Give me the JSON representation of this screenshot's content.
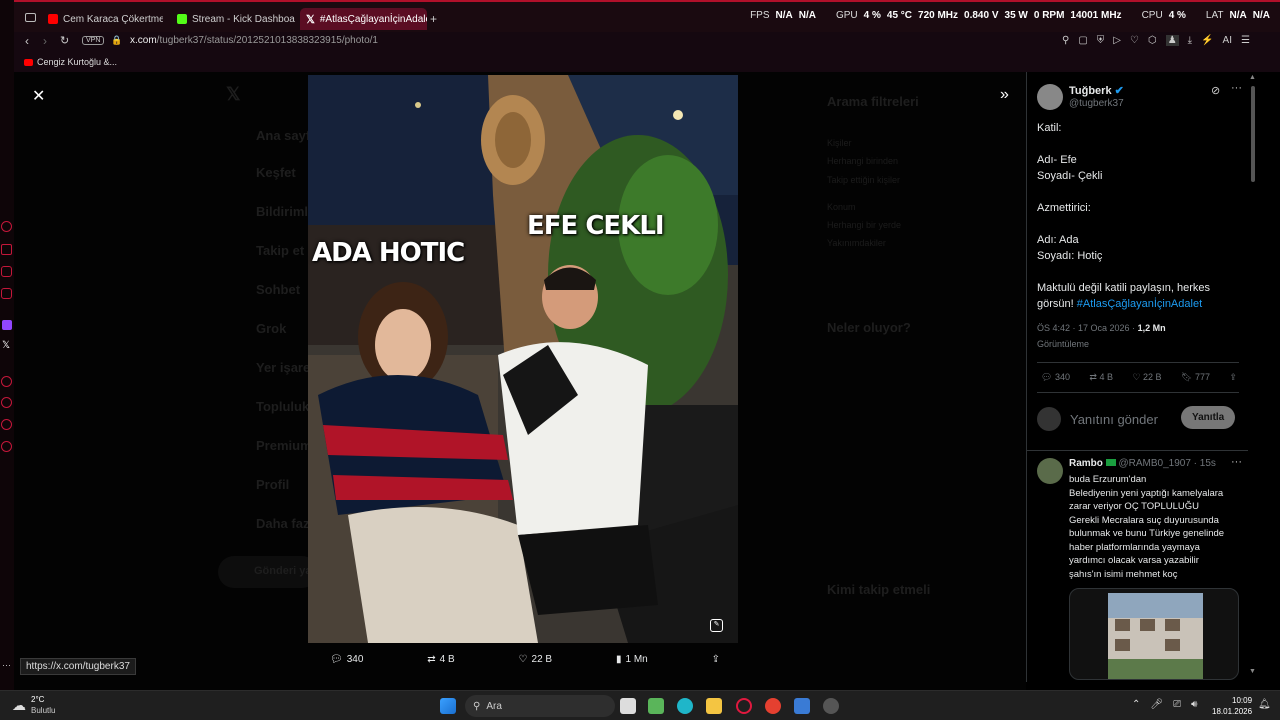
{
  "browser": {
    "tabs": [
      {
        "label": "Cem Karaca Çökertme, Ce",
        "color": "#ff0000"
      },
      {
        "label": "Stream - Kick Dashboard",
        "color": "#53fc18"
      },
      {
        "label": "#AtlasÇağlayanİçinAdalet",
        "color": "#ffffff"
      }
    ],
    "add_tab": "+",
    "url_host": "x.com",
    "url_path": "/tugberk37/status/2012521013838323915/photo/1",
    "vpn_label": "VPN",
    "bookmark": "Cengiz Kurtoğlu &...",
    "ai_label": "AI",
    "status_url": "https://x.com/tugberk37"
  },
  "perf": {
    "fps_label": "FPS",
    "fps1": "N/A",
    "fps2": "N/A",
    "gpu_label": "GPU",
    "gpu_pct": "4 %",
    "gpu_temp": "45 °C",
    "gpu_clock": "720 MHz",
    "gpu_volt": "0.840 V",
    "gpu_power": "35 W",
    "gpu_rpm": "0 RPM",
    "gpu_mem": "14001 MHz",
    "cpu_label": "CPU",
    "cpu_pct": "4 %",
    "lat_label": "LAT",
    "lat1": "N/A",
    "lat2": "N/A"
  },
  "photo": {
    "label_left": "ADA HOTIC",
    "label_right": "EFE CEKLI",
    "actions": {
      "replies": "340",
      "reposts": "4 B",
      "likes": "22 B",
      "views": "1 Mn"
    }
  },
  "backdrop": {
    "nav": [
      "Ana sayfa",
      "Keşfet",
      "Bildirimler",
      "Takip et",
      "Sohbet",
      "Grok",
      "Yer işaretleri",
      "Topluluklar",
      "Premium",
      "Profil",
      "Daha fazla"
    ],
    "post_button": "Gönderi yayınla",
    "search_filters": "Arama filtreleri",
    "filter_people": "Kişiler",
    "filter_everyone": "Herhangi birinden",
    "filter_follow": "Takip ettiğin kişiler",
    "filter_location": "Konum",
    "filter_anywhere": "Herhangi bir yerde",
    "filter_near": "Yakınımdakiler",
    "trending_title": "Neler oluyor?",
    "follow_title": "Kimi takip etmeli"
  },
  "tweet": {
    "author": "Tuğberk",
    "handle": "@tugberk37",
    "lines": [
      "Katil:",
      "",
      "Adı- Efe",
      "Soyadı- Çekli",
      "",
      "Azmettirici:",
      "",
      "Adı: Ada",
      "Soyadı: Hotiç",
      "",
      "Maktulü değil katili paylaşın, herkes",
      "görsün!"
    ],
    "hashtag": "#AtlasÇağlayanİçinAdalet",
    "time": "ÖS 4:42 · 17 Oca 2026 · ",
    "views": "1,2 Mn",
    "views_label": "Görüntüleme",
    "stats": {
      "replies": "340",
      "reposts": "4 B",
      "likes": "22 B",
      "bookmarks": "777"
    },
    "reply_placeholder": "Yanıtını gönder",
    "reply_button": "Yanıtla"
  },
  "reply": {
    "author": "Rambo",
    "handle": "@RAMB0_1907 · 15s",
    "lines": [
      "buda Erzurum'dan",
      "Belediyenin yeni yaptığı kamelyalara",
      "zarar veriyor OÇ TOPLULUĞU",
      "Gerekli Mecralara suç duyurusunda",
      "bulunmak ve bunu Türkiye genelinde",
      "haber platformlarında yaymaya",
      "yardımcı olacak varsa yazabilir",
      "şahıs'ın isimi mehmet koç"
    ]
  },
  "taskbar": {
    "weather_temp": "2°C",
    "weather_desc": "Bulutlu",
    "search": "Ara",
    "time": "10:09",
    "date": "18.01.2026"
  }
}
